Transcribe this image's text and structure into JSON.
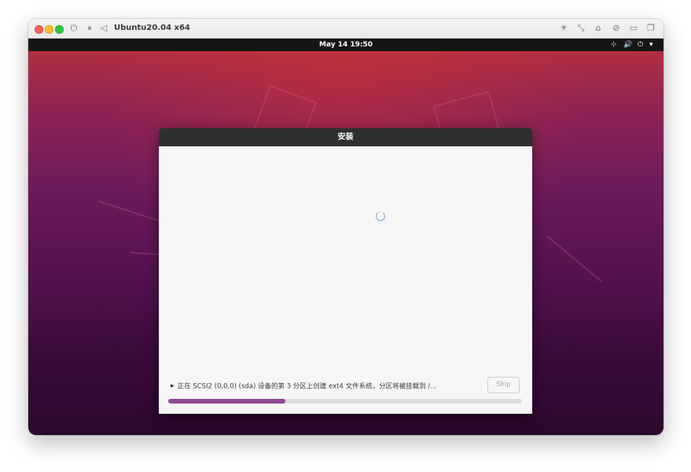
{
  "vm": {
    "title": "Ubuntu20.04 x64",
    "toolbar_icons": [
      "power-icon",
      "pause-icon",
      "back-icon",
      "brightness-icon",
      "resize-icon",
      "usb-icon",
      "block-icon",
      "share-folder-icon",
      "windows-icon"
    ]
  },
  "ubuntu_topbar": {
    "clock": "May 14  19:50",
    "tray_icons": [
      "network-icon",
      "volume-icon",
      "power-icon",
      "dropdown-arrow-icon"
    ]
  },
  "installer": {
    "title": "安装",
    "status_text": "正在 SCSI2 (0,0,0) (sda) 设备的第 3 分区上创建 ext4 文件系统，分区将被挂载到 /...",
    "skip_label": "Skip",
    "progress_fraction": 0.33,
    "progress_color": "#8f4a94"
  },
  "colors": {
    "accent": "#8f4a94",
    "topbar": "#151515",
    "dialog_header": "#2f2f2f"
  }
}
